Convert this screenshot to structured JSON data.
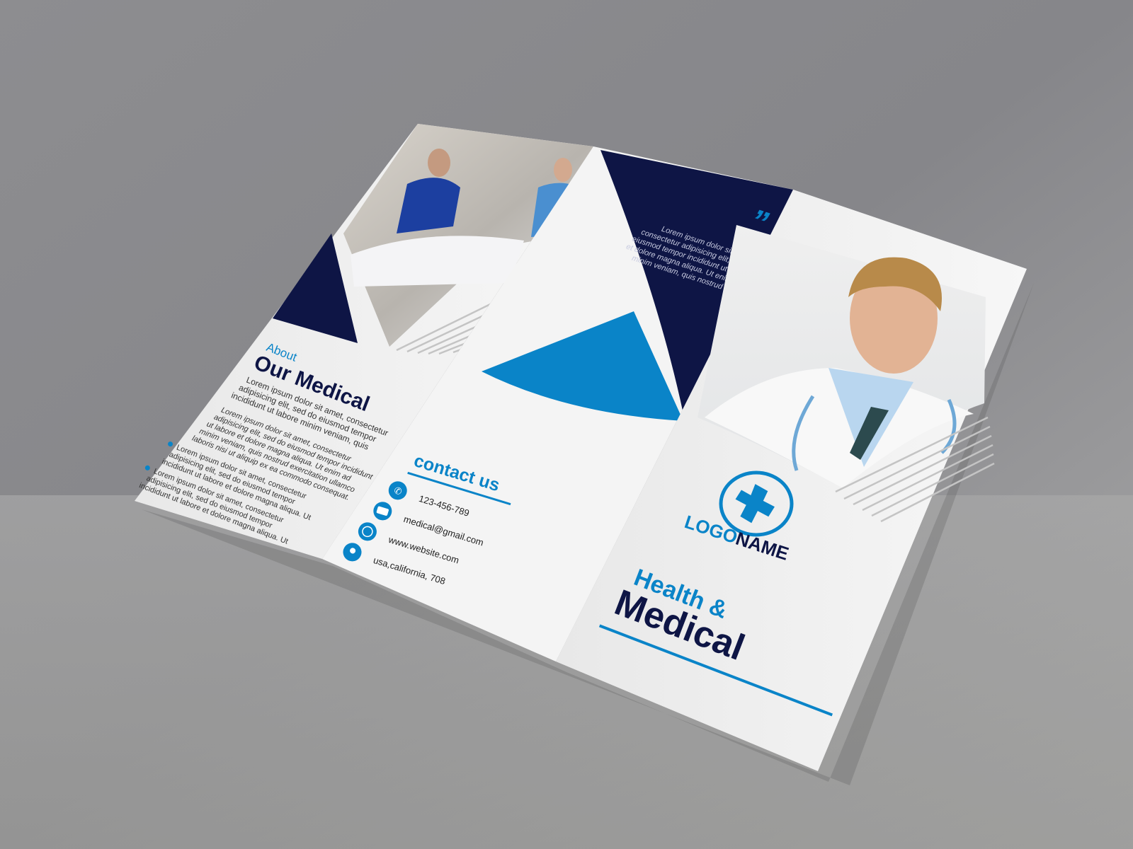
{
  "colors": {
    "navy": "#0e1545",
    "blue": "#0a84c8",
    "paper": "#f2f2f2",
    "background": "#9a9a9c"
  },
  "left_panel": {
    "kicker": "About",
    "title": "Our Medical",
    "intro": [
      "Lorem ipsum dolor sit amet, consectetur",
      "adipisicing elit, sed do eiusmod tempor",
      "incididunt ut labore minim veniam, quis"
    ],
    "body": [
      "Lorem ipsum dolor sit amet, consectetur",
      "adipisicing elit, sed do eiusmod tempor incididunt",
      "ut labore et dolore magna aliqua. Ut enim ad",
      "minim veniam, quis nostrud exercitation ullamco",
      "laboris nisi ut aliquip ex ea commodo consequat."
    ],
    "bullets": [
      [
        "Lorem ipsum dolor sit amet, consectetur",
        "adipisicing elit, sed do eiusmod tempor",
        "incididunt ut labore et dolore magna aliqua. Ut"
      ],
      [
        "Lorem ipsum dolor sit amet, consectetur",
        "adipisicing elit, sed do eiusmod tempor",
        "incididunt ut labore et dolore magna aliqua. Ut"
      ]
    ]
  },
  "middle_panel": {
    "quote_mark": "”",
    "quote": [
      "Lorem ipsum dolor sit amet,",
      "consectetur adipisicing elit, sed do",
      "eiusmod tempor incididunt ut labore",
      "et dolore magna aliqua. Ut enim ad",
      "minim veniam, quis nostrud"
    ],
    "contact_title": "contact us",
    "contacts": [
      {
        "icon": "phone-icon",
        "text": "123-456-789"
      },
      {
        "icon": "email-icon",
        "text": "medical@gmail.com"
      },
      {
        "icon": "globe-icon",
        "text": "www.website.com"
      },
      {
        "icon": "location-pin-icon",
        "text": "usa,california, 708"
      }
    ]
  },
  "right_panel": {
    "logo_part1": "LOGO",
    "logo_part2": "NAME",
    "headline1": "Health &",
    "headline2": "Medical"
  }
}
